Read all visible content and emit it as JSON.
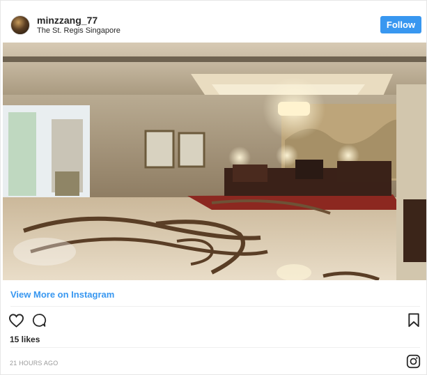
{
  "post": {
    "username": "minzzang_77",
    "location": "The St. Regis Singapore",
    "follow_label": "Follow",
    "view_more_label": "View More on Instagram",
    "likes_text": "15 likes",
    "timestamp": "21 HOURS AGO"
  },
  "icons": {
    "like": "heart-icon",
    "comment": "comment-icon",
    "save": "bookmark-icon",
    "brand": "instagram-icon"
  },
  "colors": {
    "accent": "#3897f0",
    "text": "#262626",
    "muted": "#999999",
    "divider": "#efefef"
  }
}
